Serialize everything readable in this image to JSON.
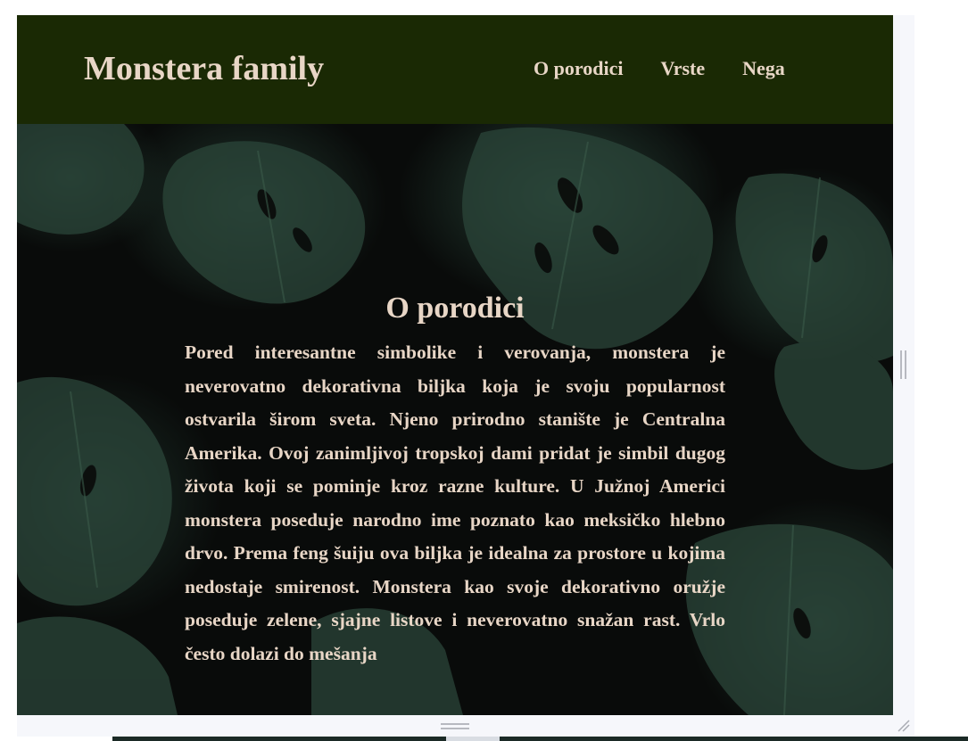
{
  "header": {
    "brand": "Monstera family",
    "nav": [
      {
        "label": "O porodici"
      },
      {
        "label": "Vrste"
      },
      {
        "label": "Nega"
      }
    ]
  },
  "hero": {
    "section_title": "O porodici",
    "paragraph": "Pored interesantne simbolike i verovanja, monstera je neverovatno dekorativna biljka koja je svoju popularnost ostvarila širom sveta. Njeno prirodno stanište je Centralna Amerika. Ovoj zanimljivoj tropskoj dami pridat je simbil dugog života koji se pominje kroz razne kulture. U Južnoj Americi monstera poseduje narodno ime poznato kao meksičko hlebno drvo. Prema feng šuiju ova biljka je idealna za prostore u kojima nedostaje smirenost. Monstera kao svoje dekorativno oružje poseduje zelene, sjajne listove i neverovatno snažan rast. Vrlo često dolazi do mešanja"
  },
  "colors": {
    "header_bg": "#1a2904",
    "text": "#e8d6c6",
    "hero_bg": "#090b0a",
    "leaf": "#2b4639"
  },
  "icons": {
    "resize_right": "resize-handle-icon",
    "resize_bottom": "resize-handle-icon",
    "resize_corner": "resize-corner-icon"
  }
}
